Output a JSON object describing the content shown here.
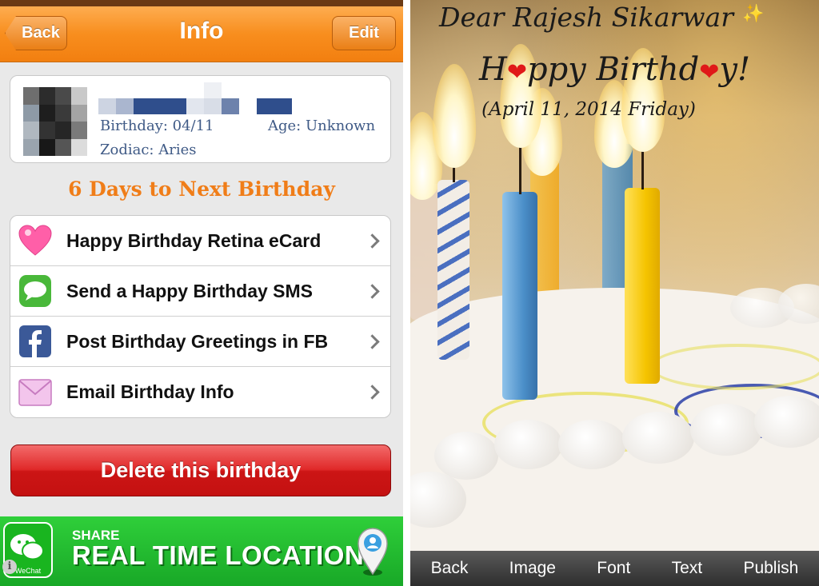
{
  "left": {
    "navbar": {
      "back_label": "Back",
      "title": "Info",
      "edit_label": "Edit"
    },
    "profile": {
      "birthday": "Birthday: 04/11",
      "age": "Age:  Unknown",
      "zodiac": "Zodiac: Aries"
    },
    "countdown": "6 Days to Next Birthday",
    "actions": [
      {
        "label": "Happy Birthday Retina eCard",
        "icon": "heart-icon"
      },
      {
        "label": "Send a Happy Birthday SMS",
        "icon": "sms-icon"
      },
      {
        "label": "Post Birthday Greetings in FB",
        "icon": "facebook-icon"
      },
      {
        "label": "Email Birthday Info",
        "icon": "email-icon"
      }
    ],
    "delete_label": "Delete this birthday",
    "ad": {
      "app": "WeChat",
      "share": "SHARE",
      "headline": "REAL TIME LOCATION"
    }
  },
  "right": {
    "greeting_name": "Dear Rajesh Sikarwar",
    "greeting_parts": [
      "H",
      "ppy Birthd",
      "y!"
    ],
    "greeting_date": "(April 11, 2014  Friday)",
    "toolbar": [
      "Back",
      "Image",
      "Font",
      "Text",
      "Publish"
    ]
  },
  "colors": {
    "nav_orange": "#f88e1e",
    "countdown_orange": "#f07d18",
    "delete_red": "#d81e1e",
    "ad_green": "#1fb52c"
  }
}
